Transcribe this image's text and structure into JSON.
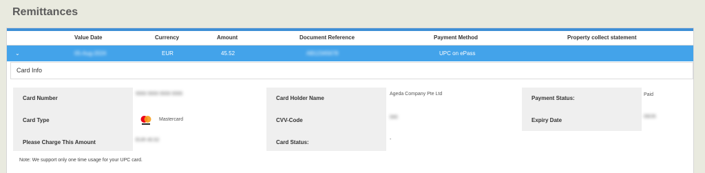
{
  "page": {
    "title": "Remittances"
  },
  "table": {
    "headers": [
      "Value Date",
      "Currency",
      "Amount",
      "Document Reference",
      "Payment Method",
      "Property collect statement"
    ],
    "row": {
      "value_date": "05-Aug-2024",
      "currency": "EUR",
      "amount": "45.52",
      "document_reference": "AB12345678",
      "payment_method": "UPC on ePass",
      "property_collect_statement": ""
    }
  },
  "card_info": {
    "title": "Card Info",
    "labels": {
      "card_number": "Card Number",
      "card_type": "Card Type",
      "please_charge": "Please Charge This Amount",
      "card_holder_name": "Card Holder Name",
      "cvv_code": "CVV-Code",
      "card_status": "Card Status:",
      "payment_status": "Payment Status:",
      "expiry_date": "Expiry Date"
    },
    "values": {
      "card_number": "5555 5555 5555 5555",
      "card_type": "Mastercard",
      "please_charge": "EUR 45.52",
      "card_holder_name": "Ageda Company Pte Ltd",
      "cvv_code": "000",
      "card_status": "-",
      "payment_status": "Paid",
      "expiry_date": "09/26"
    },
    "card_type_icon": "mastercard-icon",
    "note": "Note: We support only one time usage for your UPC card."
  },
  "colors": {
    "accent": "#43a3ea",
    "panel_border": "#3e8fd6",
    "background": "#e9eadf"
  }
}
